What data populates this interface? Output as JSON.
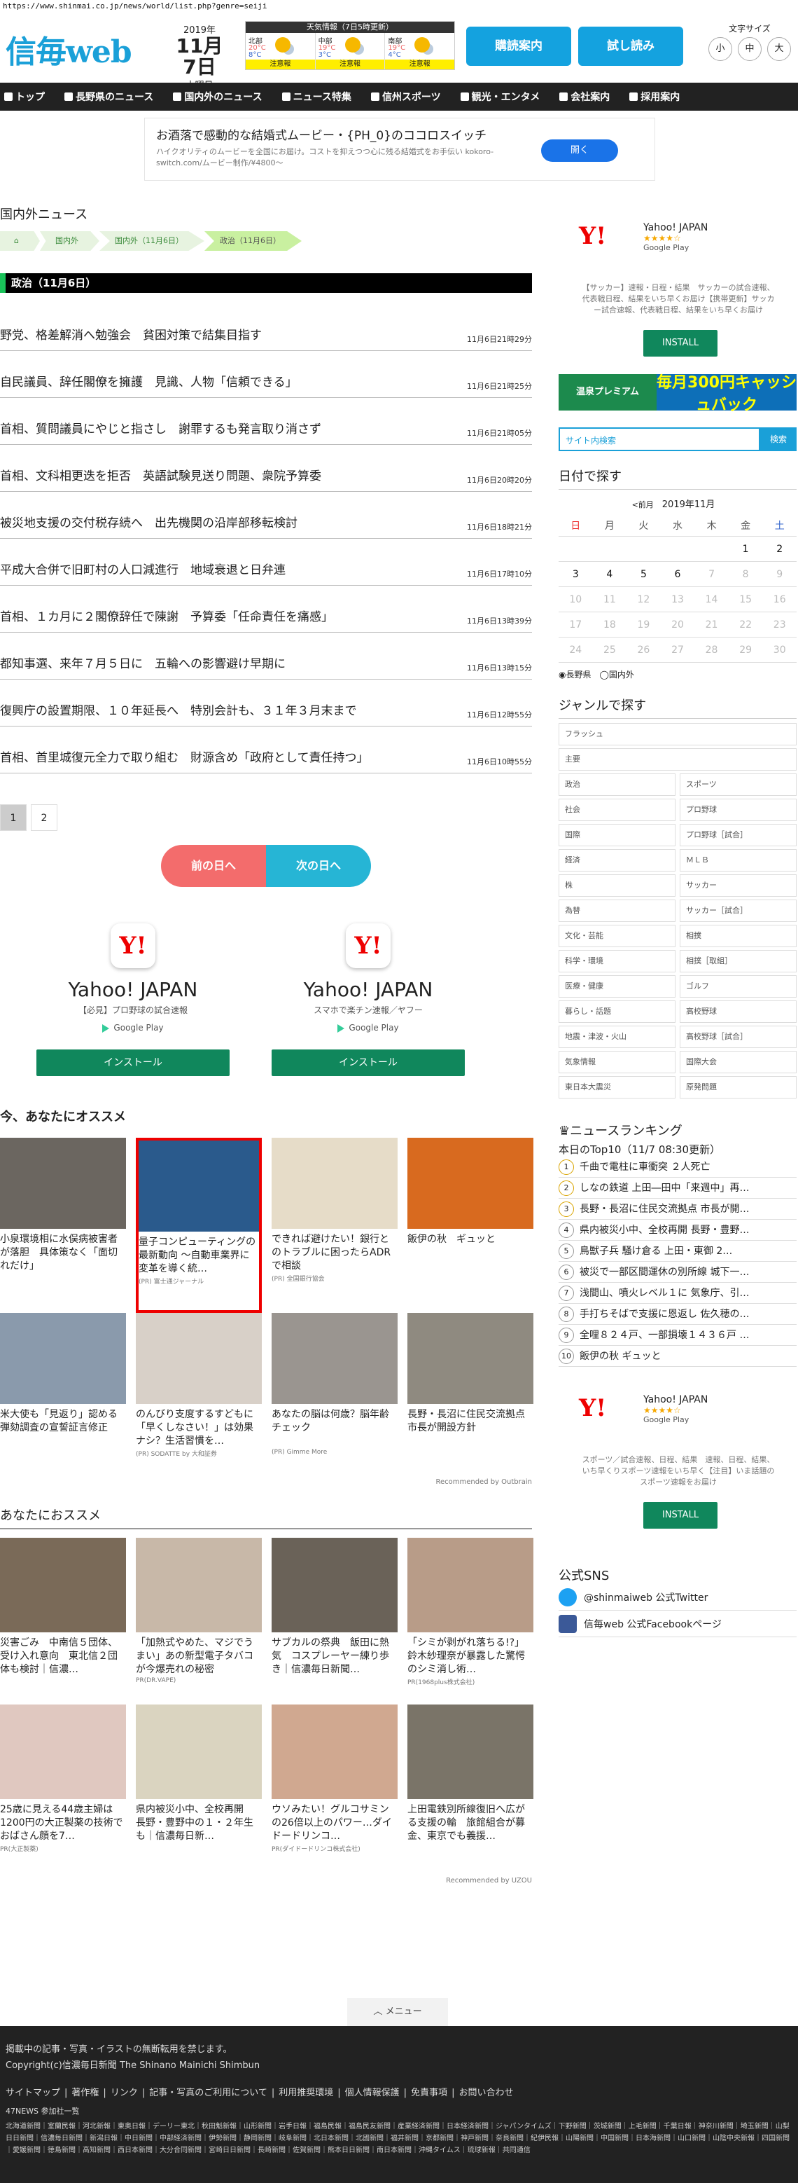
{
  "url": "https://www.shinmai.co.jp/news/world/list.php?genre=seiji",
  "header": {
    "logo": "信毎web",
    "year": "2019年",
    "monthday": "11月7日",
    "weekday": "木曜日",
    "weather_title": "天気情報（7日5時更新）",
    "weather": [
      {
        "area": "北部",
        "hi": "20°C",
        "lo": "8°C",
        "warn": "注意報"
      },
      {
        "area": "中部",
        "hi": "19°C",
        "lo": "3°C",
        "warn": "注意報"
      },
      {
        "area": "南部",
        "hi": "19°C",
        "lo": "4°C",
        "warn": "注意報"
      }
    ],
    "subscribe": "購読案内",
    "trial": "試し読み",
    "fontsize_label": "文字サイズ",
    "fs_small": "小",
    "fs_mid": "中",
    "fs_large": "大"
  },
  "nav": [
    "トップ",
    "長野県のニュース",
    "国内外のニュース",
    "ニュース特集",
    "信州スポーツ",
    "観光・エンタメ",
    "会社案内",
    "採用案内"
  ],
  "topad": {
    "title": "お酒落で感動的な結婚式ムービー・{PH_0}のココロスイッチ",
    "desc": "ハイクオリティのムービーを全国にお届け。コストを抑えつつ心に残る結婚式をお手伝い kokoro-switch.com/ムービー制作/¥4800〜",
    "open": "開く"
  },
  "main": {
    "section": "国内外ニュース",
    "breadcrumb": [
      "国内外",
      "国内外（11月6日）",
      "政治（11月6日）"
    ],
    "bar": "政治（11月6日）",
    "news": [
      {
        "title": "野党、格差解消へ勉強会　貧困対策で結集目指す",
        "time": "11月6日21時29分"
      },
      {
        "title": "自民議員、辞任閣僚を擁護　見識、人物「信頼できる」",
        "time": "11月6日21時25分"
      },
      {
        "title": "首相、質問議員にやじと指さし　謝罪するも発言取り消さず",
        "time": "11月6日21時05分"
      },
      {
        "title": "首相、文科相更迭を拒否　英語試験見送り問題、衆院予算委",
        "time": "11月6日20時20分"
      },
      {
        "title": "被災地支援の交付税存続へ　出先機関の沿岸部移転検討",
        "time": "11月6日18時21分"
      },
      {
        "title": "平成大合併で旧町村の人口減進行　地域衰退と日弁連",
        "time": "11月6日17時10分"
      },
      {
        "title": "首相、１カ月に２閣僚辞任で陳謝　予算委「任命責任を痛感」",
        "time": "11月6日13時39分"
      },
      {
        "title": "都知事選、来年７月５日に　五輪への影響避け早期に",
        "time": "11月6日13時15分"
      },
      {
        "title": "復興庁の設置期限、１０年延長へ　特別会計も、３１年３月末まで",
        "time": "11月6日12時55分"
      },
      {
        "title": "首相、首里城復元全力で取り組む　財源含め「政府として責任持つ」",
        "time": "11月6日10時55分"
      }
    ],
    "pages": [
      "1",
      "2"
    ],
    "prev_day": "前の日へ",
    "next_day": "次の日へ",
    "yads": [
      {
        "title": "Yahoo! JAPAN",
        "sub": "【必見】プロ野球の試合速報",
        "gp": "Google Play",
        "btn": "インストール"
      },
      {
        "title": "Yahoo! JAPAN",
        "sub": "スマホで楽チン速報／ヤフー",
        "gp": "Google Play",
        "btn": "インストール"
      }
    ],
    "rec_title": "今、あなたにオススメ",
    "rec": [
      {
        "caption": "小泉環境相に水俣病被害者が落胆　具体策なく「面切れだけ」",
        "src": "",
        "color": "#6b6660"
      },
      {
        "caption": "量子コンピューティングの最新動向 〜自動車業界に変革を導く統…",
        "src": "(PR) 富士通ジャーナル",
        "color": "#2a5a8c"
      },
      {
        "caption": "できれば避けたい！銀行とのトラブルに困ったらADRで相談",
        "src": "(PR) 全国銀行協会",
        "color": "#e6dcc8"
      },
      {
        "caption": "飯伊の秋　ギュッと",
        "src": "",
        "color": "#d86a1f"
      },
      {
        "caption": "米大使も「見返り」認める　弾劾調査の宣誓証言修正",
        "src": "",
        "color": "#8a9aac"
      },
      {
        "caption": "のんびり支度するすどもに「早くしなさい！」は効果ナシ？生活習慣を…",
        "src": "(PR) SODATTE by 大和証券",
        "color": "#d8d0c8"
      },
      {
        "caption": "あなたの脳は何歳？脳年齢チェック",
        "src": "(PR) Gimme More",
        "color": "#9a9590"
      },
      {
        "caption": "長野・長沼に住民交流拠点　市長が開設方針",
        "src": "",
        "color": "#8f8a80"
      }
    ],
    "outbrain": "Recommended by Outbrain",
    "rec2_title": "あなたにおススメ",
    "rec2": [
      {
        "caption": "災害ごみ　中南信５団体、受け入れ意向　東北信２団体も検討｜信濃…",
        "src": "",
        "color": "#7a6a58"
      },
      {
        "caption": "「加熱式やめた、マジでうまい」あの新型電子タバコが今爆売れの秘密",
        "src": "PR(DR.VAPE)",
        "color": "#c8b8a8"
      },
      {
        "caption": "サブカルの祭典　飯田に熱気　コスプレーヤー練り歩き｜信濃毎日新聞…",
        "src": "",
        "color": "#6a6258"
      },
      {
        "caption": "「シミが剥がれ落ちる!?」鈴木紗理奈が暴露した驚愕のシミ消し術…",
        "src": "PR(1968plus株式会社)",
        "color": "#b89c88"
      },
      {
        "caption": "25歳に見える44歳主婦は1200円の大正製薬の技術でおばさん顔を7…",
        "src": "PR(大正製薬)",
        "color": "#e0c8c0"
      },
      {
        "caption": "県内被災小中、全校再開　長野・豊野中の１・２年生も｜信濃毎日新…",
        "src": "",
        "color": "#dad4c0"
      },
      {
        "caption": "ウソみたい！グルコサミンの26倍以上のパワー…ダイドードリンコ…",
        "src": "PR(ダイドードリンコ株式会社)",
        "color": "#d0a890"
      },
      {
        "caption": "上田電鉄別所線復旧へ広がる支援の輪　旅館組合が募金、東京でも義援…",
        "src": "",
        "color": "#7a7468"
      }
    ],
    "uzou": "Recommended by UZOU",
    "menu": "メニュー"
  },
  "side": {
    "ad1": {
      "title": "Yahoo! JAPAN",
      "stars": "★★★★☆",
      "gp": "Google Play",
      "desc": "【サッカー】速報・日程・結果　サッカーの試合速報、代表戦日程、結果をいち早くお届け【携帯更新】サッカー試合速報、代表戦日程、結果をいち早くお届け",
      "btn": "INSTALL"
    },
    "banner_l": "温泉プレミアム",
    "banner_r": "毎月300円キャッシュバック",
    "search_ph": "サイト内検索",
    "search_btn": "検索",
    "date_title": "日付で探す",
    "prev_month": "<前月",
    "month": "2019年11月",
    "weekdays": [
      "日",
      "月",
      "火",
      "水",
      "木",
      "金",
      "土"
    ],
    "days": [
      "",
      "",
      "",
      "",
      "",
      "1",
      "2",
      "3",
      "4",
      "5",
      "6",
      "7",
      "8",
      "9",
      "10",
      "11",
      "12",
      "13",
      "14",
      "15",
      "16",
      "17",
      "18",
      "19",
      "20",
      "21",
      "22",
      "23",
      "24",
      "25",
      "26",
      "27",
      "28",
      "29",
      "30"
    ],
    "radio_1": "◉長野県",
    "radio_2": "◯国内外",
    "genre_title": "ジャンルで探す",
    "genre_flash": "フラッシュ",
    "genre_main": "主要",
    "genres": [
      [
        "政治",
        "スポーツ"
      ],
      [
        "社会",
        "プロ野球"
      ],
      [
        "国際",
        "プロ野球［試合］"
      ],
      [
        "経済",
        "ＭＬＢ"
      ],
      [
        "株",
        "サッカー"
      ],
      [
        "為替",
        "サッカー［試合］"
      ],
      [
        "文化・芸能",
        "相撲"
      ],
      [
        "科学・環境",
        "相撲［取組］"
      ],
      [
        "医療・健康",
        "ゴルフ"
      ],
      [
        "暮らし・話題",
        "高校野球"
      ],
      [
        "地震・津波・火山",
        "高校野球［試合］"
      ],
      [
        "気象情報",
        "国際大会"
      ],
      [
        "東日本大震災",
        "原発問題"
      ]
    ],
    "rank_title": "ニュースランキング",
    "rank_date": "本日のTop10（11/7 08:30更新）",
    "ranking": [
      "千曲で電柱に車衝突 ２人死亡",
      "しなの鉄道 上田―田中「来週中」再…",
      "長野・長沼に住民交流拠点 市長が開…",
      "県内被災小中、全校再開 長野・豊野…",
      "鳥獣子兵 騒け倉る 上田・東御 2…",
      "被災で一部区間運休の別所線 城下一…",
      "浅間山、噴火レベル１に 気象庁、引…",
      "手打ちそばで支援に恩返し 佐久穂の…",
      "全哩８２４戸、一部損壊１４３６戸 …",
      "飯伊の秋 ギュッと"
    ],
    "ad2": {
      "title": "Yahoo! JAPAN",
      "stars": "★★★★☆",
      "gp": "Google Play",
      "desc": "スポーツ／試合速報、日程、結果　速報、日程、結果、いち早くりスポーツ速報をいち早く【注目】いま話題のスポーツ速報をお届け",
      "btn": "INSTALL"
    },
    "sns_title": "公式SNS",
    "twitter": "@shinmaiweb 公式Twitter",
    "facebook": "信毎web 公式Facebookページ"
  },
  "footer": {
    "notice": "掲載中の記事・写真・イラストの無断転用を禁じます。",
    "copyright": "Copyright(c)信濃毎日新聞 The Shinano Mainichi Shimbun",
    "links": [
      "サイトマップ",
      "著作権",
      "リンク",
      "記事・写真のご利用について",
      "利用推奨環境",
      "個人情報保護",
      "免責事項",
      "お問い合わせ"
    ],
    "partners_title": "47NEWS 参加社一覧",
    "partners": "北海道新聞｜室蘭民報｜河北新報｜東奥日報｜デーリー東北｜秋田魁新報｜山形新聞｜岩手日報｜福島民報｜福島民友新聞｜産業経済新聞｜日本経済新聞｜ジャパンタイムズ｜下野新聞｜茨城新聞｜上毛新聞｜千葉日報｜神奈川新聞｜埼玉新聞｜山梨日日新聞｜信濃毎日新聞｜新潟日報｜中日新聞｜中部経済新聞｜伊勢新聞｜静岡新聞｜岐阜新聞｜北日本新聞｜北國新聞｜福井新聞｜京都新聞｜神戸新聞｜奈良新聞｜紀伊民報｜山陽新聞｜中国新聞｜日本海新聞｜山口新聞｜山陰中央新報｜四国新聞｜愛媛新聞｜徳島新聞｜高知新聞｜西日本新聞｜大分合同新聞｜宮崎日日新聞｜長崎新聞｜佐賀新聞｜熊本日日新聞｜南日本新聞｜沖縄タイムス｜琉球新報｜共同通信"
  }
}
